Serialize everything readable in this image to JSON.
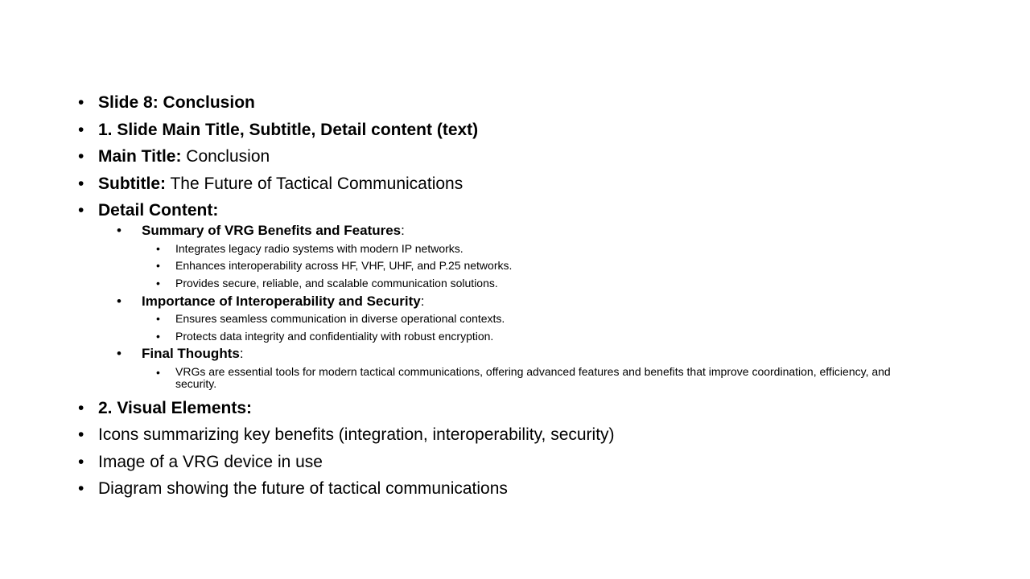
{
  "bullet_char": "•",
  "items": [
    {
      "bold": "Slide 8: Conclusion",
      "rest": ""
    },
    {
      "bold": "1. Slide Main Title, Subtitle, Detail content (text)",
      "rest": ""
    },
    {
      "bold": "Main Title:",
      "rest": " Conclusion"
    },
    {
      "bold": "Subtitle:",
      "rest": " The Future of Tactical Communications"
    },
    {
      "bold": "Detail Content:",
      "rest": ""
    }
  ],
  "detail": {
    "summary": {
      "heading": "Summary of VRG Benefits and Features",
      "colon": ":",
      "points": [
        "Integrates legacy radio systems with modern IP networks.",
        "Enhances interoperability across HF, VHF, UHF, and P.25 networks.",
        "Provides secure, reliable, and scalable communication solutions."
      ]
    },
    "importance": {
      "heading": "Importance of Interoperability and Security",
      "colon": ":",
      "points": [
        "Ensures seamless communication in diverse operational contexts.",
        "Protects data integrity and confidentiality with robust encryption."
      ]
    },
    "final": {
      "heading": "Final Thoughts",
      "colon": ":",
      "points": [
        "VRGs are essential tools for modern tactical communications, offering advanced features and benefits that improve coordination, efficiency, and security."
      ]
    }
  },
  "visual": {
    "heading": "2. Visual Elements:",
    "points": [
      "Icons summarizing key benefits (integration, interoperability, security)",
      "Image of a VRG device in use",
      "Diagram showing the future of tactical communications"
    ]
  }
}
